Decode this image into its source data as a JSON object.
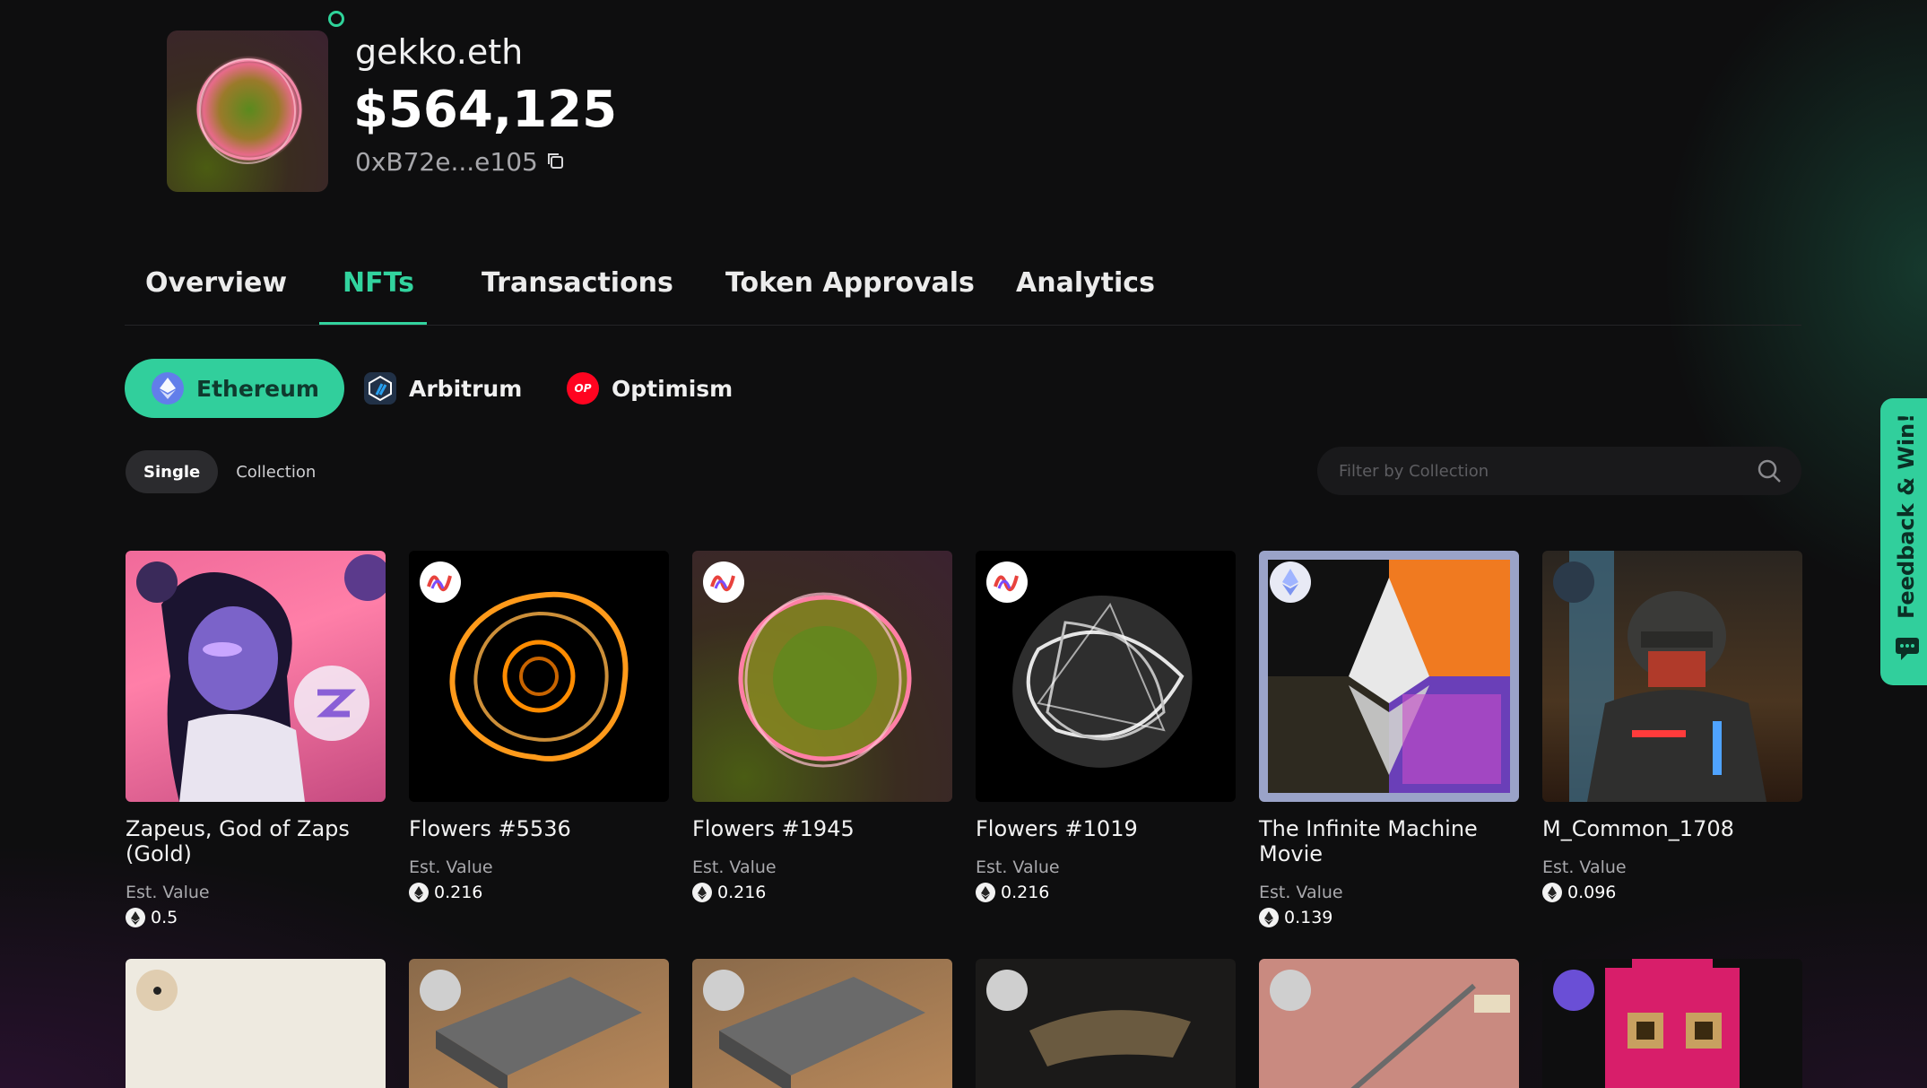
{
  "profile": {
    "ens_name": "gekko.eth",
    "balance": "$564,125",
    "address": "0xB72e...e105"
  },
  "tabs": [
    {
      "label": "Overview",
      "active": false
    },
    {
      "label": "NFTs",
      "active": true
    },
    {
      "label": "Transactions",
      "active": false
    },
    {
      "label": "Token Approvals",
      "active": false
    },
    {
      "label": "Analytics",
      "active": false
    }
  ],
  "chains": [
    {
      "label": "Ethereum",
      "active": true,
      "icon": "ethereum-icon"
    },
    {
      "label": "Arbitrum",
      "active": false,
      "icon": "arbitrum-icon"
    },
    {
      "label": "Optimism",
      "active": false,
      "icon": "optimism-icon",
      "icon_text": "OP"
    }
  ],
  "view_toggle": {
    "single": "Single",
    "collection": "Collection",
    "active": "single"
  },
  "filter": {
    "placeholder": "Filter by Collection",
    "value": ""
  },
  "nfts": [
    {
      "name": "Zapeus, God of Zaps (Gold)",
      "est_label": "Est. Value",
      "value": "0.5"
    },
    {
      "name": "Flowers #5536",
      "est_label": "Est. Value",
      "value": "0.216"
    },
    {
      "name": "Flowers #1945",
      "est_label": "Est. Value",
      "value": "0.216"
    },
    {
      "name": "Flowers #1019",
      "est_label": "Est. Value",
      "value": "0.216"
    },
    {
      "name": "The Infinite Machine Movie",
      "est_label": "Est. Value",
      "value": "0.139"
    },
    {
      "name": "M_Common_1708",
      "est_label": "Est. Value",
      "value": "0.096"
    }
  ],
  "feedback": {
    "label": "Feedback & Win!"
  },
  "colors": {
    "accent": "#31cf9c",
    "background": "#0e0e0f",
    "optimism": "#ff0420",
    "ethereum": "#627eea"
  }
}
